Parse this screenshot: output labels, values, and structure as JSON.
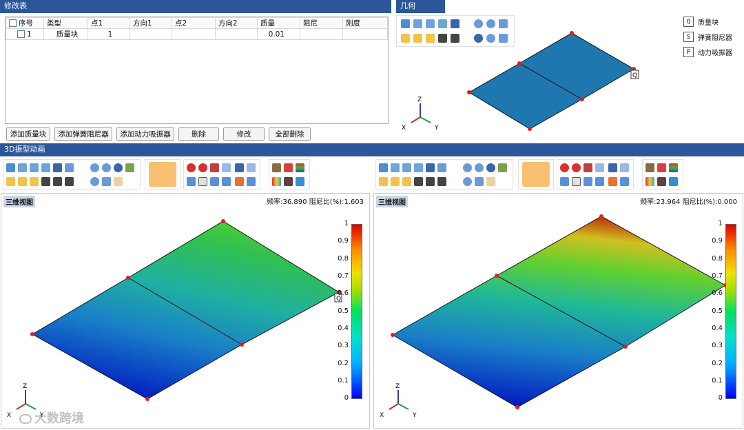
{
  "edit_panel": {
    "title": "修改表",
    "columns": [
      "序号",
      "类型",
      "点1",
      "方向1",
      "点2",
      "方向2",
      "质量",
      "阻尼",
      "刚度"
    ],
    "rows": [
      {
        "index": "1",
        "type": "质量块",
        "p1": "1",
        "d1": "",
        "p2": "",
        "d2": "",
        "mass": "0.01",
        "damp": "",
        "stiff": ""
      }
    ],
    "buttons": {
      "add_mass": "添加质量块",
      "add_spring": "添加弹簧阻尼器",
      "add_absorber": "添加动力吸振器",
      "delete": "删除",
      "modify": "修改",
      "delete_all": "全部删除"
    }
  },
  "geometry_panel": {
    "title": "几何",
    "legend": [
      {
        "key": "Q",
        "label": "质量块"
      },
      {
        "key": "S",
        "label": "弹簧阻尼器"
      },
      {
        "key": "P",
        "label": "动力吸振器"
      }
    ],
    "marker": "Q",
    "axes": {
      "z": "Z",
      "x": "X",
      "y": "Y"
    }
  },
  "anim_panel": {
    "title": "3D振型动画",
    "left_view": {
      "label": "三维视图",
      "info": "频率:36.890 阻尼比(%):1.603",
      "marker": "Q"
    },
    "right_view": {
      "label": "三维视图",
      "info": "频率:23.964 阻尼比(%):0.000"
    },
    "scale_ticks": [
      "1",
      "0.9",
      "0.8",
      "0.7",
      "0.6",
      "0.5",
      "0.4",
      "0.3",
      "0.2",
      "0.1",
      "0"
    ],
    "axes": {
      "z": "Z",
      "x": "X",
      "y": "Y"
    }
  },
  "watermark": "大数跨境",
  "colors": {
    "header": "#2b579a",
    "mesh_blue": "#1f77b0",
    "node": "#e02020"
  }
}
